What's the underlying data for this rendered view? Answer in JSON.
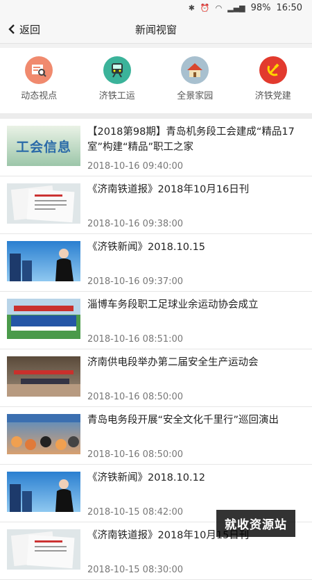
{
  "status": {
    "battery": "98%",
    "time": "16:50"
  },
  "header": {
    "back_label": "返回",
    "title": "新闻视窗"
  },
  "categories": [
    {
      "label": "动态视点",
      "color": "#f08a6e",
      "icon": "news-search-icon"
    },
    {
      "label": "济铁工运",
      "color": "#3bb39a",
      "icon": "train-icon"
    },
    {
      "label": "全景家园",
      "color": "#a8c0cf",
      "icon": "home-icon"
    },
    {
      "label": "济铁党建",
      "color": "#e23a2e",
      "icon": "party-emblem-icon"
    }
  ],
  "news": [
    {
      "title": "【2018第98期】青岛机务段工会建成“精品17室”构建“精品”职工之家",
      "date": "2018-10-16 09:40:00",
      "thumb": "工会信息"
    },
    {
      "title": "《济南铁道报》2018年10月16日刊",
      "date": "2018-10-16 09:38:00",
      "thumb": "newspaper"
    },
    {
      "title": "《济铁新闻》2018.10.15",
      "date": "2018-10-16 09:37:00",
      "thumb": "anchor"
    },
    {
      "title": "淄博车务段职工足球业余运动协会成立",
      "date": "2018-10-16 08:51:00",
      "thumb": "team"
    },
    {
      "title": "济南供电段举办第二届安全生产运动会",
      "date": "2018-10-16 08:50:00",
      "thumb": "hall"
    },
    {
      "title": "青岛电务段开展“安全文化千里行”巡回演出",
      "date": "2018-10-16 08:50:00",
      "thumb": "crowd"
    },
    {
      "title": "《济铁新闻》2018.10.12",
      "date": "2018-10-15 08:42:00",
      "thumb": "anchor"
    },
    {
      "title": "《济南铁道报》2018年10月15日刊",
      "date": "2018-10-15 08:30:00",
      "thumb": "newspaper"
    }
  ],
  "watermark": "就收资源站"
}
